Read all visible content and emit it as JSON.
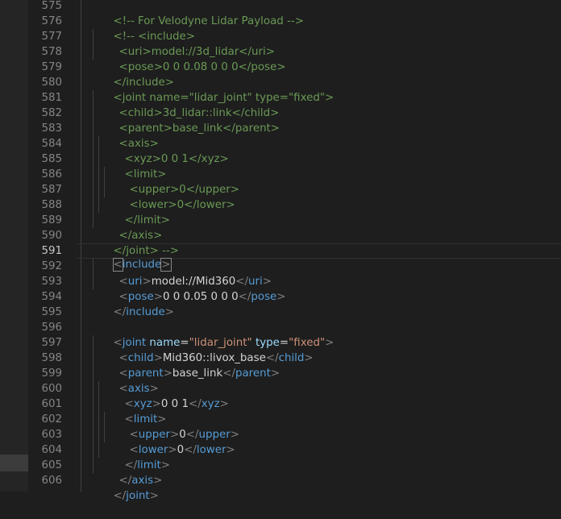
{
  "editor": {
    "colors": {
      "background": "#1e1e1e",
      "line_number": "#858585",
      "line_number_active": "#c6c6c6",
      "tag": "#569cd6",
      "attribute": "#9cdcfe",
      "string": "#ce9178",
      "comment": "#6a9955",
      "text": "#d4d4d4",
      "punctuation": "#808080"
    },
    "active_line": 591,
    "lines": [
      {
        "n": "575",
        "comment": "<!-- For Velodyne Lidar Payload -->"
      },
      {
        "n": "576",
        "comment": "<!-- <include>"
      },
      {
        "n": "577",
        "comment": "<uri>model://3d_lidar</uri>"
      },
      {
        "n": "578",
        "comment": "<pose>0 0 0.08 0 0 0</pose>"
      },
      {
        "n": "579",
        "comment": "</include>"
      },
      {
        "n": "580",
        "comment": "<joint name=\"lidar_joint\" type=\"fixed\">"
      },
      {
        "n": "581",
        "comment": "<child>3d_lidar::link</child>"
      },
      {
        "n": "582",
        "comment": "<parent>base_link</parent>"
      },
      {
        "n": "583",
        "comment": "<axis>"
      },
      {
        "n": "584",
        "comment": "<xyz>0 0 1</xyz>"
      },
      {
        "n": "585",
        "comment": "<limit>"
      },
      {
        "n": "586",
        "comment": "<upper>0</upper>"
      },
      {
        "n": "587",
        "comment": "<lower>0</lower>"
      },
      {
        "n": "588",
        "comment": "</limit>"
      },
      {
        "n": "589",
        "comment": "</axis>"
      },
      {
        "n": "590",
        "comment": "</joint> -->"
      },
      {
        "n": "591",
        "lt": "<",
        "tag": "include",
        "gt": ">"
      },
      {
        "n": "592",
        "open": "uri",
        "text": "model://Mid360",
        "close": "uri"
      },
      {
        "n": "593",
        "open": "pose",
        "text": "0 0 0.05 0 0 0",
        "close": "pose"
      },
      {
        "n": "594",
        "endtag": "include"
      },
      {
        "n": "595"
      },
      {
        "n": "596",
        "tag": "joint",
        "attr1": "name",
        "val1": "\"lidar_joint\"",
        "attr2": "type",
        "val2": "\"fixed\""
      },
      {
        "n": "597",
        "open": "child",
        "text": "Mid360::livox_base",
        "close": "child"
      },
      {
        "n": "598",
        "open": "parent",
        "text": "base_link",
        "close": "parent"
      },
      {
        "n": "599",
        "tag": "axis"
      },
      {
        "n": "600",
        "open": "xyz",
        "text": "0 0 1",
        "close": "xyz"
      },
      {
        "n": "601",
        "tag": "limit"
      },
      {
        "n": "602",
        "open": "upper",
        "text": "0",
        "close": "upper"
      },
      {
        "n": "603",
        "open": "lower",
        "text": "0",
        "close": "lower"
      },
      {
        "n": "604",
        "endtag": "limit"
      },
      {
        "n": "605",
        "endtag": "axis"
      },
      {
        "n": "606",
        "endtag": "joint"
      }
    ]
  }
}
